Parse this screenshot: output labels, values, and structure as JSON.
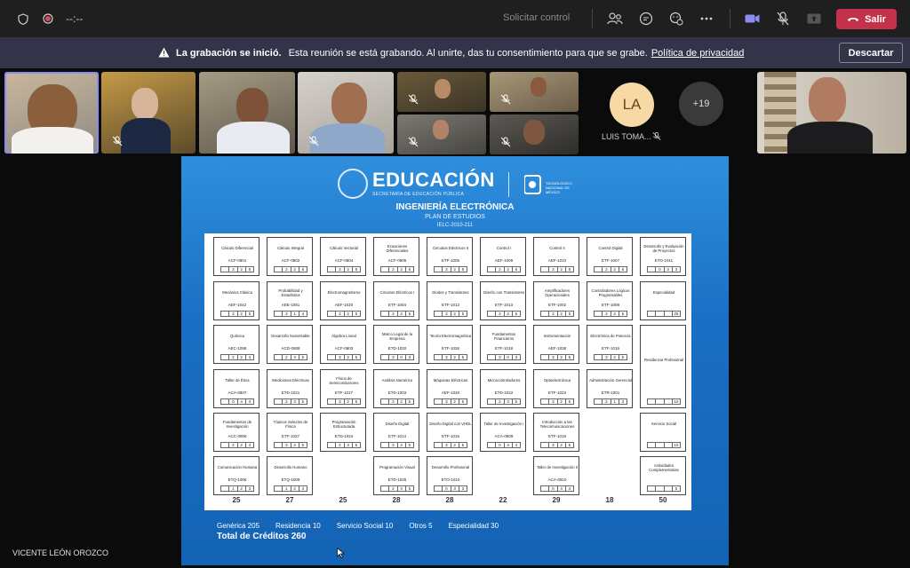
{
  "meeting": {
    "timer": "--:--",
    "request_control": "Solicitar control",
    "leave_label": "Salir"
  },
  "banner": {
    "title": "La grabación se inició.",
    "message": "Esta reunión se está grabando. Al unirte, das tu consentimiento para que se grabe.",
    "privacy_link": "Política de privacidad",
    "dismiss_label": "Descartar"
  },
  "participants": {
    "la_initials": "LA",
    "la_name": "LUIS TOMA...",
    "overflow_count": "+19"
  },
  "presenter_name": "VICENTE LEÓN OROZCO",
  "slide": {
    "logo_text": "EDUCACIÓN",
    "logo_sub": "SECRETARÍA DE EDUCACIÓN PÚBLICA",
    "tecnm_text": "TECNOLÓGICO NACIONAL DE MÉXICO",
    "career": "INGENIERÍA ELECTRÓNICA",
    "plan": "PLAN DE ESTUDIOS",
    "plan_id": "IELC-2010-211",
    "column_sums": [
      "25",
      "27",
      "25",
      "28",
      "28",
      "22",
      "29",
      "18",
      "50"
    ],
    "totals": {
      "generica": "Genérica 205",
      "residencia": "Residencia 10",
      "servicio": "Servicio Social 10",
      "otros": "Otros    5",
      "especialidad": "Especialidad 30",
      "grand_total": "Total de Créditos 260"
    },
    "courses": [
      {
        "name": "Cálculo Diferencial",
        "code": "ACF-0901",
        "credits": [
          "",
          "3",
          "2",
          "5"
        ]
      },
      {
        "name": "Cálculo Integral",
        "code": "ACF-0902",
        "credits": [
          "",
          "3",
          "2",
          "5"
        ]
      },
      {
        "name": "Cálculo Vectorial",
        "code": "ACF-0904",
        "credits": [
          "",
          "3",
          "2",
          "5"
        ]
      },
      {
        "name": "Ecuaciones Diferenciales",
        "code": "ACF-0905",
        "credits": [
          "",
          "3",
          "2",
          "5"
        ]
      },
      {
        "name": "Circuitos Eléctricos II",
        "code": "ETF-1005",
        "credits": [
          "",
          "3",
          "2",
          "5"
        ]
      },
      {
        "name": "Control I",
        "code": "AEF-1009",
        "credits": [
          "",
          "3",
          "2",
          "5"
        ]
      },
      {
        "name": "Control II",
        "code": "AEF-1010",
        "credits": [
          "",
          "3",
          "2",
          "5"
        ]
      },
      {
        "name": "Control Digital",
        "code": "ETF-1007",
        "credits": [
          "",
          "3",
          "2",
          "5"
        ]
      },
      {
        "name": "Desarrollo y Evaluación de Proyectos",
        "code": "ETO-1011",
        "credits": [
          "",
          "0",
          "3",
          "3"
        ]
      },
      {
        "name": "Mecánica Clásica",
        "code": "AEF-1042",
        "credits": [
          "",
          "3",
          "2",
          "5"
        ]
      },
      {
        "name": "Probabilidad y Estadística",
        "code": "AEE-1051",
        "credits": [
          "",
          "3",
          "1",
          "4"
        ]
      },
      {
        "name": "Electromagnetismo",
        "code": "AEF-1020",
        "credits": [
          "",
          "3",
          "2",
          "5"
        ]
      },
      {
        "name": "Circuitos Eléctricos I",
        "code": "ETF-1004",
        "credits": [
          "",
          "3",
          "2",
          "5"
        ]
      },
      {
        "name": "Diodos y Transistores",
        "code": "ETF-1012",
        "credits": [
          "",
          "3",
          "2",
          "5"
        ]
      },
      {
        "name": "Diseño con Transistores",
        "code": "ETF-1013",
        "credits": [
          "",
          "3",
          "2",
          "5"
        ]
      },
      {
        "name": "Amplificadores Operacionales",
        "code": "ETF-1002",
        "credits": [
          "",
          "3",
          "2",
          "5"
        ]
      },
      {
        "name": "Controladores Lógicos Programables",
        "code": "ETF-1008",
        "credits": [
          "",
          "3",
          "2",
          "5"
        ]
      },
      {
        "name": "Especialidad",
        "code": "",
        "credits": [
          "",
          "",
          "",
          "25"
        ]
      },
      {
        "name": "Química",
        "code": "AEC-1058",
        "credits": [
          "",
          "2",
          "2",
          "4"
        ]
      },
      {
        "name": "Desarrollo Sustentable",
        "code": "ACD-0908",
        "credits": [
          "",
          "2",
          "3",
          "5"
        ]
      },
      {
        "name": "Álgebra Lineal",
        "code": "ACF-0903",
        "credits": [
          "",
          "3",
          "2",
          "5"
        ]
      },
      {
        "name": "Marco Legal de la Empresa",
        "code": "ETD-1020",
        "credits": [
          "",
          "3",
          "0",
          "3"
        ]
      },
      {
        "name": "Teoría Electromagnética",
        "code": "ETF-1026",
        "credits": [
          "",
          "3",
          "2",
          "5"
        ]
      },
      {
        "name": "Fundamentos Financieros",
        "code": "ETF-1018",
        "credits": [
          "",
          "3",
          "0",
          "3"
        ]
      },
      {
        "name": "Instrumentación",
        "code": "AEF-1038",
        "credits": [
          "",
          "3",
          "2",
          "5"
        ]
      },
      {
        "name": "Electrónica de Potencia",
        "code": "ETF-1016",
        "credits": [
          "",
          "3",
          "2",
          "5"
        ]
      },
      {
        "name": "Residencia Profesional",
        "code": "",
        "credits": [
          "",
          "",
          "",
          "10"
        ]
      },
      {
        "name": "Taller de Ética",
        "code": "ACA-0907",
        "credits": [
          "",
          "0",
          "4",
          "4"
        ]
      },
      {
        "name": "Mediciones Eléctricas",
        "code": "ETD-1021",
        "credits": [
          "",
          "2",
          "3",
          "5"
        ]
      },
      {
        "name": "Física de Semiconductores",
        "code": "ETF-1017",
        "credits": [
          "",
          "3",
          "2",
          "5"
        ]
      },
      {
        "name": "Análisis Numérico",
        "code": "ETD-1003",
        "credits": [
          "",
          "3",
          "2",
          "5"
        ]
      },
      {
        "name": "Máquinas Eléctricas",
        "code": "AEF-1040",
        "credits": [
          "",
          "3",
          "2",
          "5"
        ]
      },
      {
        "name": "Microcontroladores",
        "code": "ETD-1022",
        "credits": [
          "",
          "2",
          "3",
          "5"
        ]
      },
      {
        "name": "Optoelectrónica",
        "code": "ETF-1023",
        "credits": [
          "",
          "3",
          "2",
          "5"
        ]
      },
      {
        "name": "Administración Gerencial",
        "code": "ETR-1001",
        "credits": [
          "",
          "2",
          "1",
          "3"
        ]
      },
      {
        "name": "Fundamentos de Investigación",
        "code": "ACC-0906",
        "credits": [
          "",
          "2",
          "2",
          "4"
        ]
      },
      {
        "name": "Tópicos Selectos de Física",
        "code": "ETF-1027",
        "credits": [
          "",
          "3",
          "2",
          "5"
        ]
      },
      {
        "name": "Programación Estructurada",
        "code": "ETD-1024",
        "credits": [
          "",
          "2",
          "3",
          "5"
        ]
      },
      {
        "name": "Diseño Digital",
        "code": "ETF-1014",
        "credits": [
          "",
          "3",
          "2",
          "5"
        ]
      },
      {
        "name": "Diseño Digital con VHDL",
        "code": "ETF-1015",
        "credits": [
          "",
          "3",
          "2",
          "5"
        ]
      },
      {
        "name": "Taller de Investigación I",
        "code": "ACA-0909",
        "credits": [
          "",
          "0",
          "4",
          "4"
        ]
      },
      {
        "name": "Introducción a las Telecomunicaciones",
        "code": "ETF-1019",
        "credits": [
          "",
          "3",
          "2",
          "5"
        ]
      },
      {
        "name": "Servicio Social",
        "code": "",
        "credits": [
          "",
          "",
          "",
          "10"
        ]
      },
      {
        "name": "Comunicación Humana",
        "code": "ETQ-1006",
        "credits": [
          "",
          "1",
          "2",
          "3"
        ]
      },
      {
        "name": "Desarrollo Humano",
        "code": "ETQ-1009",
        "credits": [
          "",
          "1",
          "2",
          "3"
        ]
      },
      {
        "name": "Programación Visual",
        "code": "ETD-1025",
        "credits": [
          "",
          "2",
          "3",
          "5"
        ]
      },
      {
        "name": "Desarrollo Profesional",
        "code": "ETO-1010",
        "credits": [
          "",
          "0",
          "3",
          "3"
        ]
      },
      {
        "name": "Taller de Investigación II",
        "code": "ACA-0910",
        "credits": [
          "",
          "0",
          "4",
          "4"
        ]
      },
      {
        "name": "Actividades Complementarias",
        "code": "",
        "credits": [
          "",
          "",
          "",
          "5"
        ]
      }
    ]
  }
}
